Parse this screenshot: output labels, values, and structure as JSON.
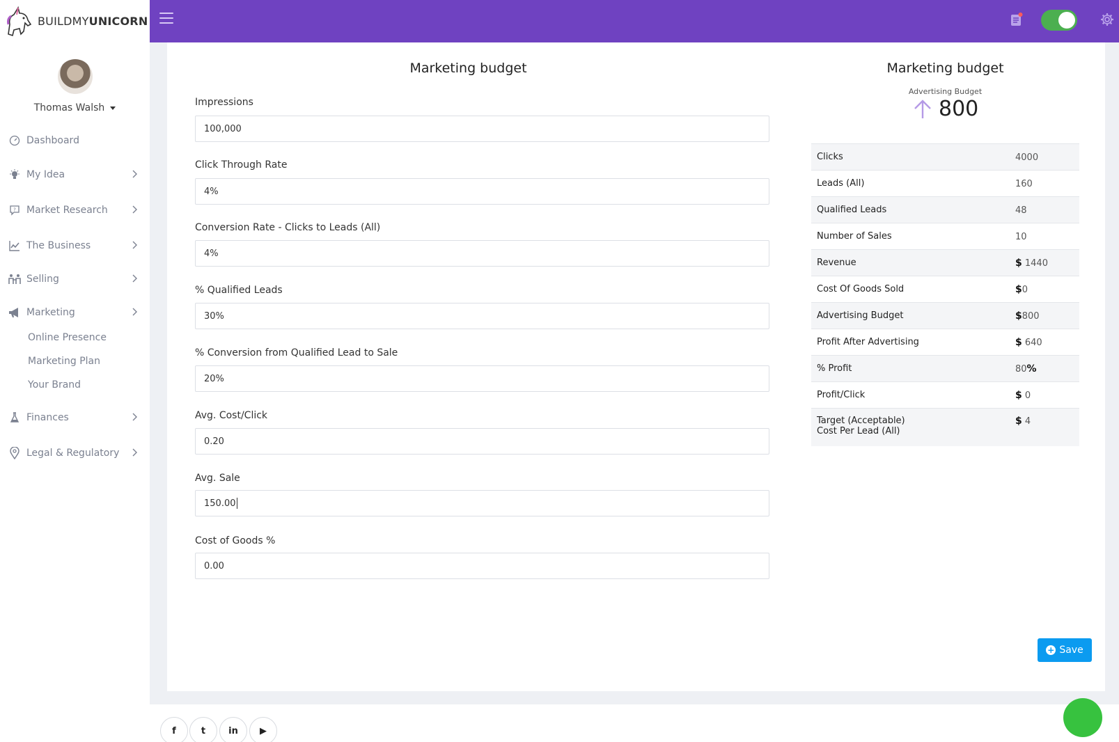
{
  "brand": {
    "prefix": "BUILDMY",
    "suffix": "UNICORN"
  },
  "user": {
    "name": "Thomas Walsh"
  },
  "sidebar": {
    "items": [
      {
        "label": "Dashboard",
        "icon": "gauge-icon"
      },
      {
        "label": "My Idea",
        "icon": "lightbulb-icon"
      },
      {
        "label": "Market Research",
        "icon": "chat-question-icon"
      },
      {
        "label": "The Business",
        "icon": "line-chart-icon"
      },
      {
        "label": "Selling",
        "icon": "people-icon"
      },
      {
        "label": "Marketing",
        "icon": "megaphone-icon"
      },
      {
        "label": "Finances",
        "icon": "flask-icon"
      },
      {
        "label": "Legal & Regulatory",
        "icon": "map-pin-icon"
      }
    ],
    "marketing_sub": [
      "Online Presence",
      "Marketing Plan",
      "Your Brand"
    ]
  },
  "form": {
    "title": "Marketing budget",
    "fields": [
      {
        "label": "Impressions",
        "value": "100,000"
      },
      {
        "label": "Click Through Rate",
        "value": "4%"
      },
      {
        "label": "Conversion Rate - Clicks to Leads (All)",
        "value": "4%"
      },
      {
        "label": "% Qualified Leads",
        "value": "30%"
      },
      {
        "label": "% Conversion from Qualified Lead to Sale",
        "value": "20%"
      },
      {
        "label": "Avg. Cost/Click",
        "value": "0.20"
      },
      {
        "label": "Avg. Sale",
        "value": "150.00"
      },
      {
        "label": "Cost of Goods %",
        "value": "0.00"
      }
    ]
  },
  "summary": {
    "title": "Marketing budget",
    "advertising_label": "Advertising Budget",
    "advertising_value": "800",
    "rows": [
      {
        "label": "Clicks",
        "currency": "",
        "value": "4000",
        "suffix": ""
      },
      {
        "label": "Leads (All)",
        "currency": "",
        "value": "160",
        "suffix": ""
      },
      {
        "label": "Qualified Leads",
        "currency": "",
        "value": "48",
        "suffix": ""
      },
      {
        "label": "Number of Sales",
        "currency": "",
        "value": "10",
        "suffix": ""
      },
      {
        "label": "Revenue",
        "currency": "$",
        "value": " 1440",
        "suffix": ""
      },
      {
        "label": "Cost Of Goods Sold",
        "currency": "$",
        "value": "0",
        "suffix": ""
      },
      {
        "label": "Advertising Budget",
        "currency": "$",
        "value": "800",
        "suffix": ""
      },
      {
        "label": "Profit After Advertising",
        "currency": "$",
        "value": " 640",
        "suffix": ""
      },
      {
        "label": "% Profit",
        "currency": "",
        "value": "80",
        "suffix": "%"
      },
      {
        "label": "Profit/Click",
        "currency": "$",
        "value": " 0",
        "suffix": ""
      },
      {
        "label": "Target (Acceptable)",
        "label2": "Cost Per Lead (All)",
        "currency": "$",
        "value": " 4",
        "suffix": ""
      }
    ]
  },
  "actions": {
    "save_label": "Save"
  },
  "social": [
    {
      "glyph": "f",
      "icon": "facebook-icon"
    },
    {
      "glyph": "t",
      "icon": "twitter-icon"
    },
    {
      "glyph": "in",
      "icon": "linkedin-icon"
    },
    {
      "glyph": "▶",
      "icon": "youtube-icon"
    }
  ],
  "colors": {
    "topbar": "#6f42c1",
    "save": "#0b9bf0",
    "toggle": "#4caf50",
    "fab": "#37c23f"
  }
}
